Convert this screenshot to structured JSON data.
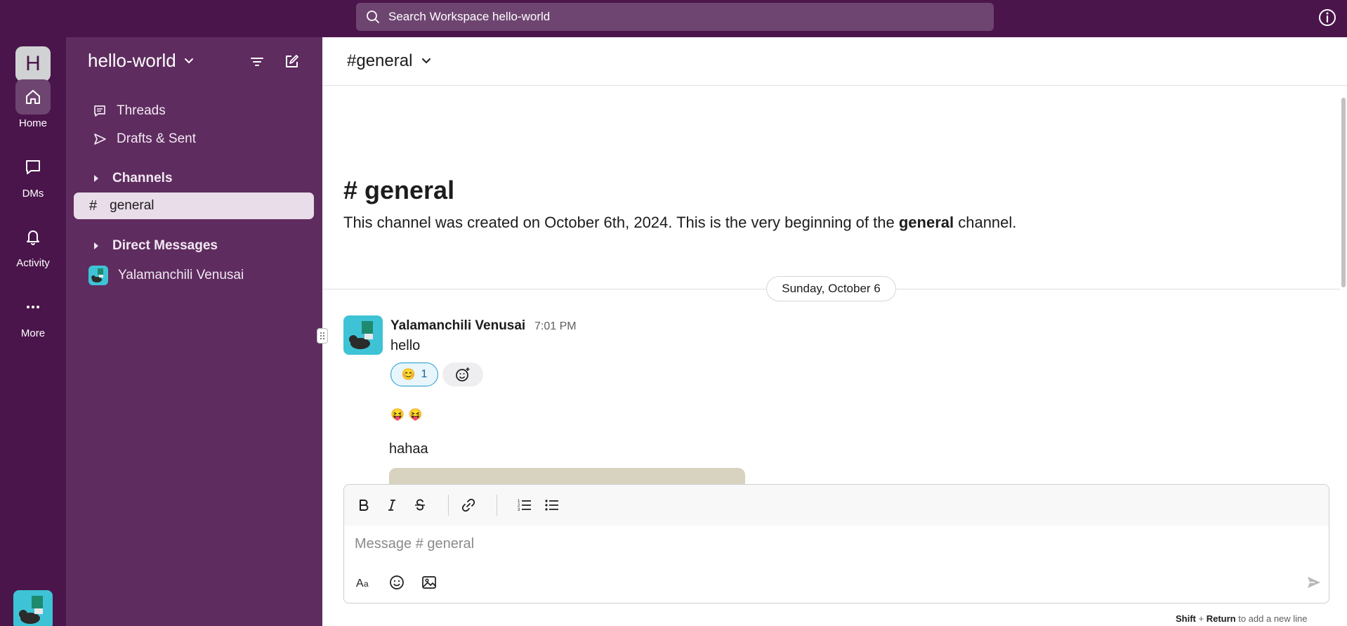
{
  "topbar": {
    "search_text": "Search Workspace hello-world"
  },
  "rail": {
    "workspace_initial": "H",
    "items": [
      {
        "label": "Home",
        "icon": "home-icon"
      },
      {
        "label": "DMs",
        "icon": "chat-bubble-icon"
      },
      {
        "label": "Activity",
        "icon": "bell-icon"
      },
      {
        "label": "More",
        "icon": "ellipsis-icon"
      }
    ]
  },
  "sidebar": {
    "workspace_name": "hello-world",
    "threads_label": "Threads",
    "drafts_label": "Drafts & Sent",
    "channels_label": "Channels",
    "channel_active": "general",
    "channel_hash": "#",
    "dms_label": "Direct Messages",
    "dm_user": "Yalamanchili Venusai"
  },
  "main": {
    "header_title": "#general",
    "intro_title": "# general",
    "intro_text_before": "This channel was created on October 6th, 2024. This is the very beginning of the ",
    "intro_text_bold": "general",
    "intro_text_after": " channel.",
    "date_pill": "Sunday, October 6",
    "message": {
      "author": "Yalamanchili Venusai",
      "time": "7:01 PM",
      "text": "hello",
      "reaction_emoji": "😊",
      "reaction_count": "1",
      "emoji_line": [
        "😝",
        "😝"
      ],
      "text2": "hahaa"
    }
  },
  "composer": {
    "placeholder": "Message # general",
    "hint_shift": "Shift",
    "hint_plus": " + ",
    "hint_return": "Return",
    "hint_rest": " to add a new line"
  },
  "colors": {
    "aubergine": "#4a154b",
    "sidebar": "#5e2c5f",
    "accent_blue": "#1d9bd1"
  }
}
